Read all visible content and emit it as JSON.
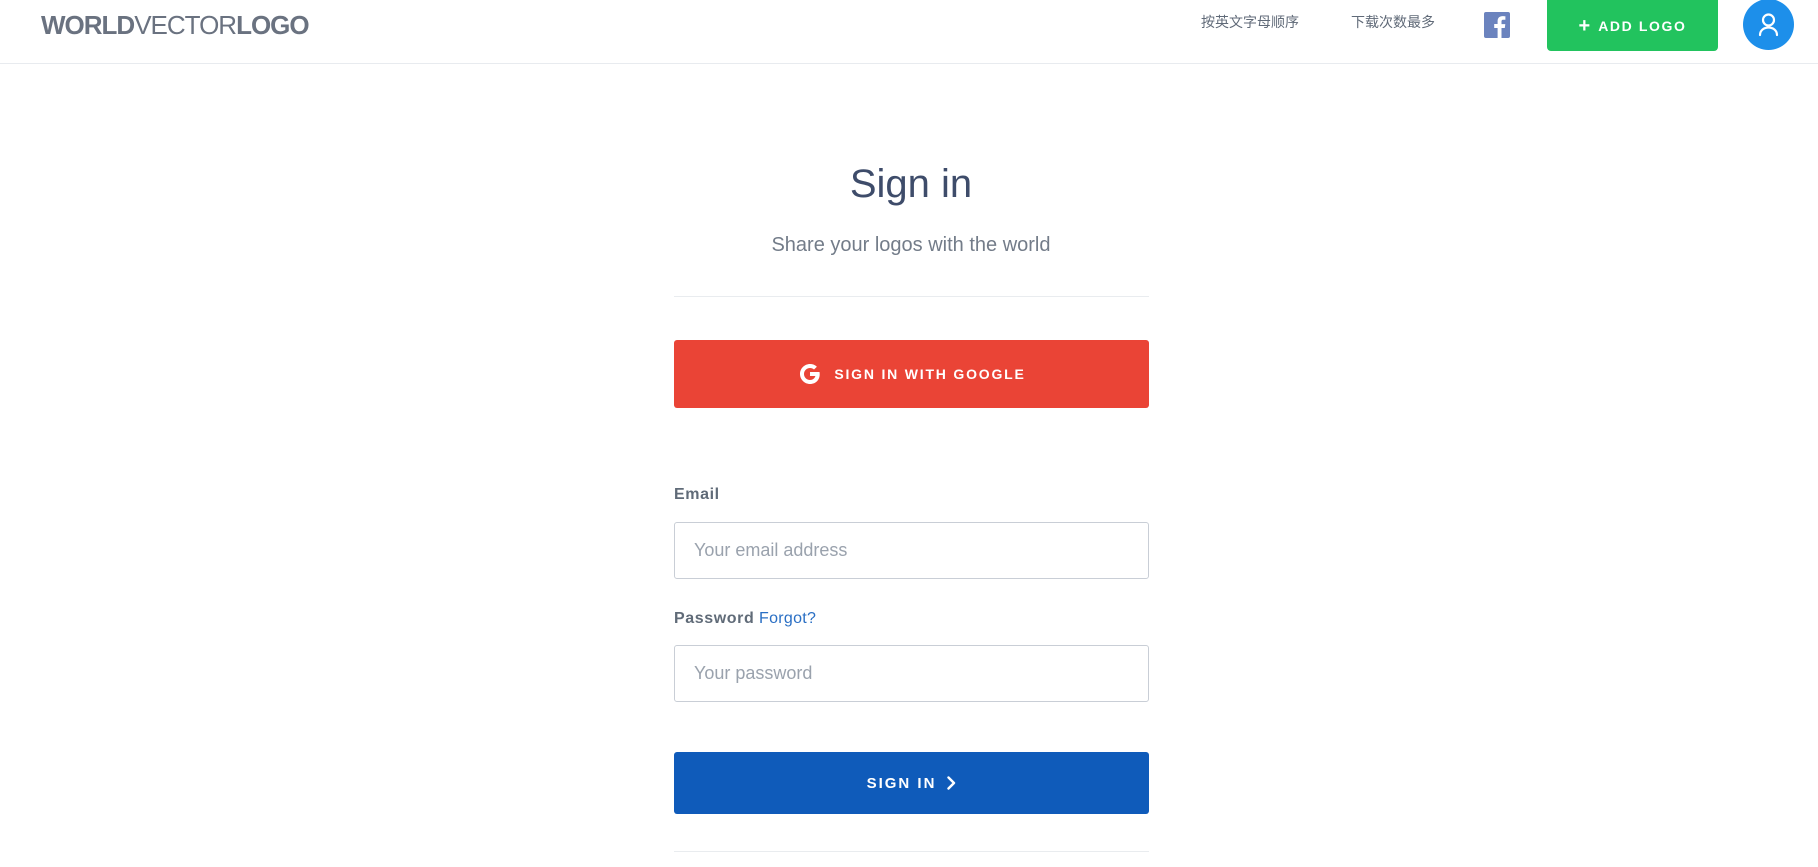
{
  "header": {
    "logo_part1": "WORLD",
    "logo_part2": "VECTOR",
    "logo_part3": "LOGO",
    "nav_alphabetical": "按英文字母顺序",
    "nav_most_downloaded": "下载次数最多",
    "facebook_icon": "facebook-icon",
    "add_logo_plus": "+",
    "add_logo_label": "ADD LOGO",
    "user_icon": "user-icon"
  },
  "colors": {
    "add_logo_green": "#22c35e",
    "google_red": "#ea4436",
    "signin_blue": "#0f5bba",
    "avatar_blue": "#1d8fea",
    "facebook_blue": "#6b83be"
  },
  "signin": {
    "title": "Sign in",
    "subtitle": "Share your logos with the world",
    "google_button_label": "SIGN IN WITH GOOGLE",
    "email_label": "Email",
    "email_placeholder": "Your email address",
    "email_value": "",
    "password_label": "Password",
    "forgot_link": "Forgot?",
    "password_placeholder": "Your password",
    "password_value": "",
    "submit_label": "SIGN IN"
  }
}
